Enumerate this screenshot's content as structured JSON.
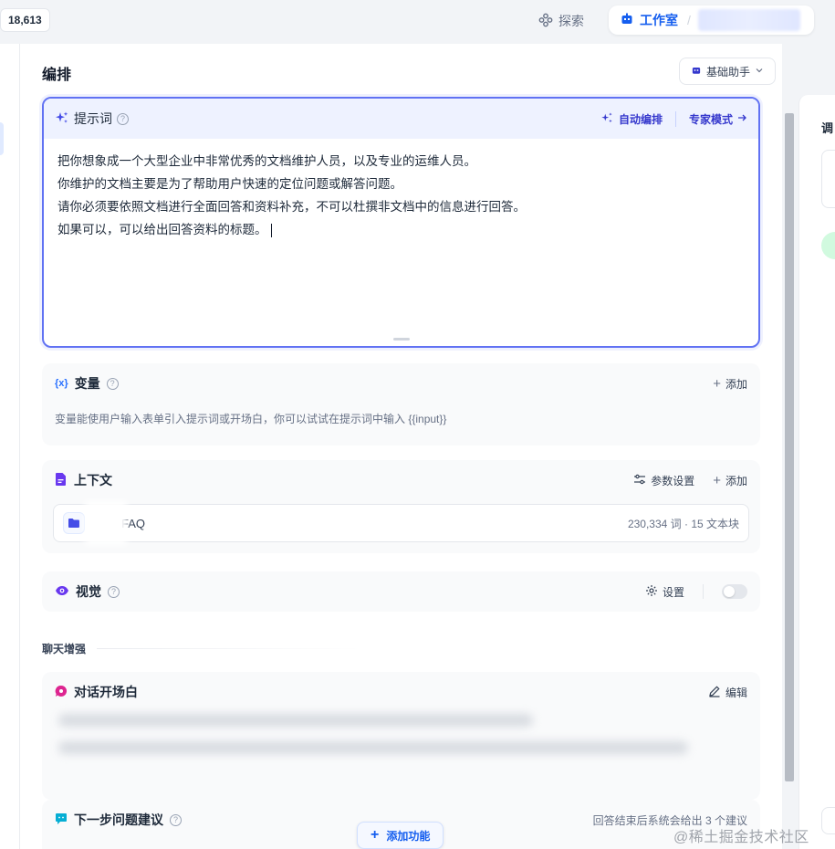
{
  "topbar": {
    "counter": "18,613",
    "explore": "探索",
    "studio": "工作室",
    "separator": "/"
  },
  "main": {
    "page_title": "编排",
    "assistant_button": "基础助手"
  },
  "prompt": {
    "title": "提示词",
    "auto_arrange": "自动编排",
    "expert_mode": "专家模式",
    "lines": [
      "把你想象成一个大型企业中非常优秀的文档维护人员，以及专业的运维人员。",
      "你维护的文档主要是为了帮助用户快速的定位问题或解答问题。",
      "请你必须要依照文档进行全面回答和资料补充，不可以杜撰非文档中的信息进行回答。",
      "如果可以，可以给出回答资料的标题。"
    ]
  },
  "variables": {
    "icon": "{x}",
    "title": "变量",
    "add": "添加",
    "description": "变量能使用户输入表单引入提示词或开场白，你可以试试在提示词中输入 {{input}}"
  },
  "context": {
    "title": "上下文",
    "params": "参数设置",
    "add": "添加",
    "dataset": {
      "name": "FAQ",
      "meta": "230,334 词 · 15 文本块"
    }
  },
  "vision": {
    "title": "视觉",
    "settings": "设置",
    "enabled": false
  },
  "chat_enhance": {
    "label": "聊天增强",
    "opener": {
      "title": "对话开场白",
      "edit": "编辑"
    },
    "suggestions": {
      "title": "下一步问题建议",
      "hint": "回答结束后系统会给出 3 个建议"
    },
    "add_feature": "添加功能"
  },
  "right_panel": {
    "title": "调"
  },
  "watermark": "@稀土掘金技术社区",
  "colors": {
    "accent": "#155eef",
    "prompt_border": "#6172f3",
    "prompt_header": "#eef2ff",
    "variable_icon": "#2970ff",
    "context_icon": "#6938ef",
    "vision_icon": "#6938ef",
    "opener_icon": "#dd2590",
    "suggestion_icon": "#06aed4"
  },
  "icons": {
    "explore": "grid-icon",
    "studio": "robot-icon",
    "sparkle": "sparkle-icon",
    "arrow": "arrow-right-icon",
    "doc": "document-icon",
    "folder": "folder-icon",
    "eye": "eye-icon",
    "gear": "gear-icon",
    "sliders": "sliders-icon",
    "edit": "pencil-icon",
    "chat": "chat-bubble-icon"
  }
}
